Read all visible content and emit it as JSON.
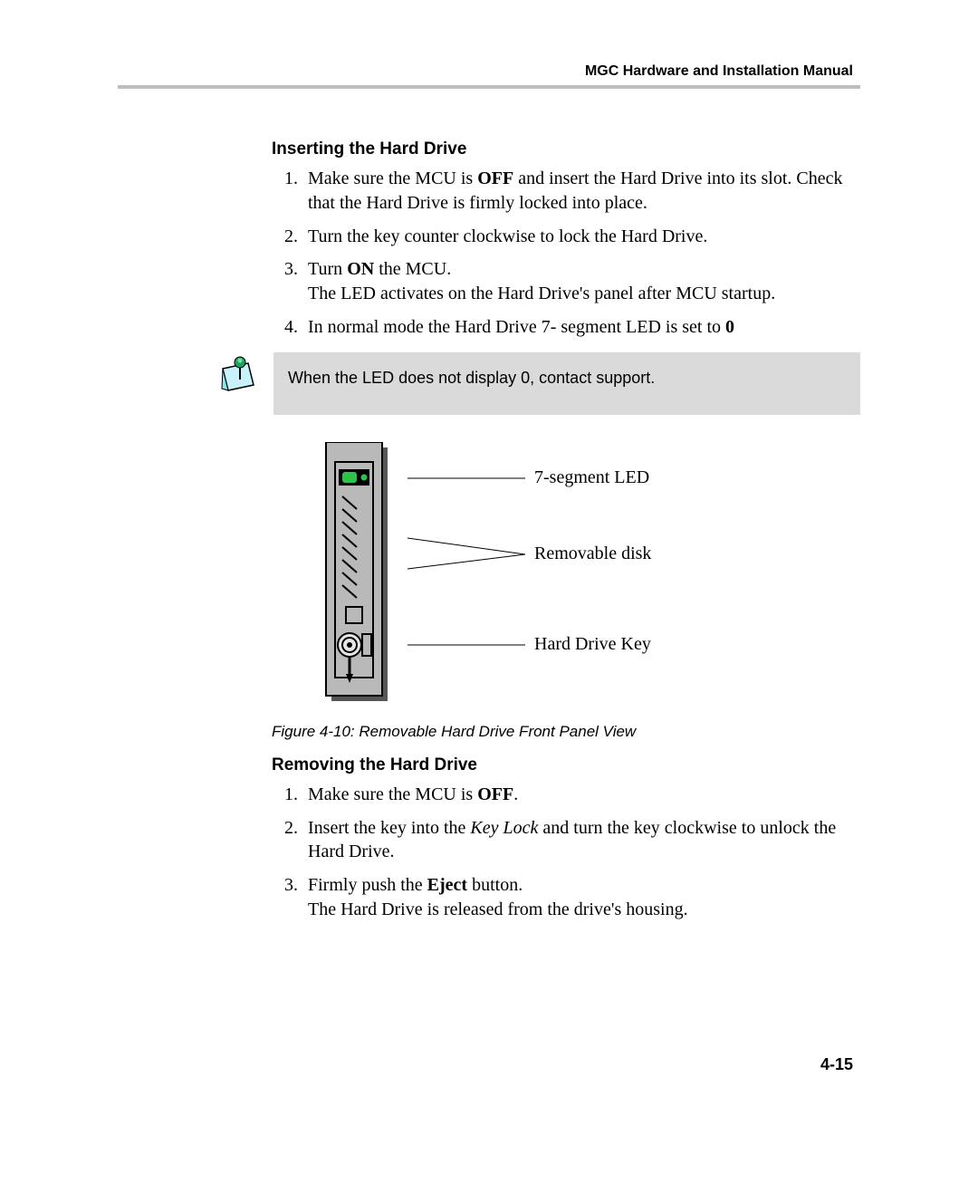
{
  "header": {
    "title": "MGC Hardware and Installation Manual"
  },
  "sections": {
    "inserting": {
      "title": "Inserting the Hard Drive",
      "steps": [
        {
          "prefix": "Make sure the MCU is ",
          "bold": "OFF",
          "suffix": " and insert the Hard Drive into its slot. Check that the Hard Drive is firmly locked into place."
        },
        {
          "prefix": "Turn the key counter clockwise to lock the Hard Drive.",
          "bold": "",
          "suffix": ""
        },
        {
          "prefix": "Turn ",
          "bold": "ON",
          "suffix": " the MCU.\nThe LED activates on the Hard Drive's panel after MCU startup."
        },
        {
          "prefix": "In normal mode the Hard Drive 7- segment LED is set to ",
          "bold": "0",
          "suffix": ""
        }
      ]
    },
    "removing": {
      "title": "Removing the Hard Drive",
      "steps": [
        {
          "prefix": "Make sure the MCU is ",
          "bold": "OFF",
          "suffix": "."
        },
        {
          "prefix": "Insert the key into the ",
          "italic": "Key Lock",
          "suffix": " and turn the key clockwise to unlock the Hard Drive."
        },
        {
          "prefix": "Firmly push the ",
          "bold": "Eject",
          "suffix": " button.\nThe Hard Drive is released from the drive's housing."
        }
      ]
    }
  },
  "note": {
    "text": "When the LED does not display 0, contact support."
  },
  "figure": {
    "callouts": {
      "led": "7-segment LED",
      "disk": "Removable disk",
      "key": "Hard Drive Key"
    },
    "caption": "Figure 4-10: Removable Hard Drive Front Panel View"
  },
  "page_number": "4-15"
}
